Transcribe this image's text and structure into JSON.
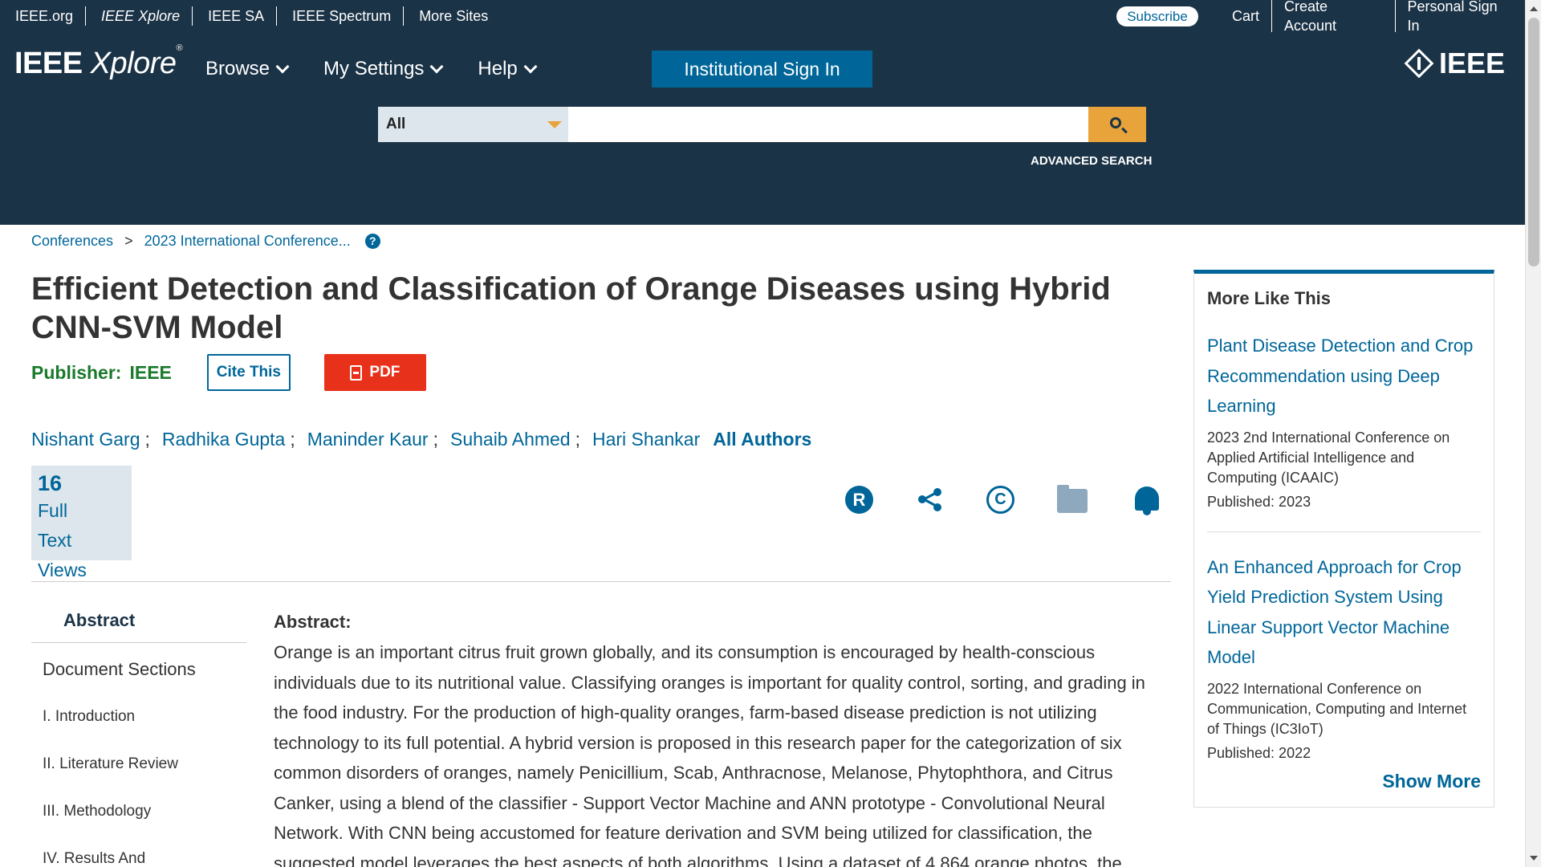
{
  "topbar": {
    "links": [
      "IEEE.org",
      "IEEE Xplore",
      "IEEE SA",
      "IEEE Spectrum",
      "More Sites"
    ],
    "subscribe": "Subscribe",
    "right_links": [
      "Cart",
      "Create Account",
      "Personal Sign In"
    ]
  },
  "header": {
    "logo_main": "IEEE",
    "logo_sub": "Xplore",
    "logo_reg": "®",
    "nav": [
      "Browse",
      "My Settings",
      "Help"
    ],
    "institutional_sign_in": "Institutional Sign In",
    "ieee_logo": "IEEE"
  },
  "search": {
    "scope": "All",
    "placeholder": "",
    "advanced": "ADVANCED SEARCH"
  },
  "breadcrumb": {
    "items": [
      "Conferences",
      "2023 International Conference..."
    ],
    "separator": ">",
    "help": "?"
  },
  "article": {
    "title": "Efficient Detection and Classification of Orange Diseases using Hybrid CNN-SVM Model",
    "publisher_label": "Publisher:",
    "publisher": "IEEE",
    "cite_button": "Cite This",
    "pdf_button": "PDF",
    "authors": [
      "Nishant Garg",
      "Radhika Gupta",
      "Maninder Kaur",
      "Suhaib Ahmed",
      "Hari Shankar"
    ],
    "author_separator": ";",
    "all_authors": "All Authors",
    "metrics": {
      "count": "16",
      "label_line1": "Full",
      "label_line2": "Text Views"
    },
    "tool_icons": [
      "rights-icon",
      "share-icon",
      "copyright-icon",
      "folder-icon",
      "bell-icon"
    ],
    "tools": {
      "rights_glyph": "R",
      "copyright_glyph": "C"
    }
  },
  "sidenav": {
    "abstract": "Abstract",
    "document_sections": "Document Sections",
    "sections": [
      "I.  Introduction",
      "II.  Literature Review",
      "III.  Methodology",
      "IV.  Results And"
    ]
  },
  "abstract": {
    "heading": "Abstract:",
    "text": "Orange is an important citrus fruit grown globally, and its consumption is encouraged by health-conscious individuals due to its nutritional value. Classifying oranges is important for quality control, sorting, and grading in the food industry. For the production of high-quality oranges, farm-based disease prediction is not utilizing technology to its full potential. A hybrid version is proposed in this research paper for the categorization of six common disorders of oranges, namely Penicillium, Scab, Anthracnose, Melanose, Phytophthora, and Citrus Canker, using a blend of the classifier - Support Vector Machine and ANN prototype - Convolutional Neural Network. With CNN being accustomed for feature derivation and SVM being utilized for classification, the suggested model leverages the best aspects of both algorithms. Using a dataset of 4,864 orange photos, the"
  },
  "more_like_this": {
    "heading": "More Like This",
    "items": [
      {
        "title": "Plant Disease Detection and Crop Recommendation using Deep Learning",
        "conference": "2023 2nd International Conference on Applied Artificial Intelligence and Computing (ICAAIC)",
        "published": "Published: 2023"
      },
      {
        "title": "An Enhanced Approach for Crop Yield Prediction System Using Linear Support Vector Machine Model",
        "conference": "2022 International Conference on Communication, Computing and Internet of Things (IC3IoT)",
        "published": "Published: 2022"
      }
    ],
    "show_more": "Show More"
  },
  "colors": {
    "header_bg": "#1b3347",
    "link": "#006699",
    "accent_search": "#e8a33a",
    "pdf_red": "#e8311a",
    "publisher_green": "#1a7a2b"
  }
}
